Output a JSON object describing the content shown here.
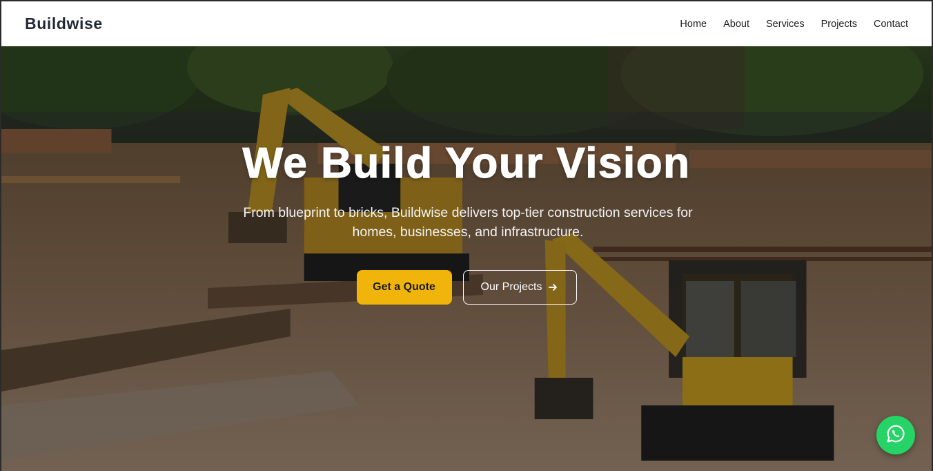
{
  "brand": {
    "name": "Buildwise"
  },
  "nav": {
    "items": [
      {
        "label": "Home"
      },
      {
        "label": "About"
      },
      {
        "label": "Services"
      },
      {
        "label": "Projects"
      },
      {
        "label": "Contact"
      }
    ]
  },
  "hero": {
    "title": "We Build Your Vision",
    "subtitle": "From blueprint to bricks, Buildwise delivers top-tier construction services for homes, businesses, and infrastructure.",
    "primary_cta": "Get a Quote",
    "secondary_cta": "Our Projects",
    "secondary_cta_icon": "arrow-right-icon",
    "background_image": "construction-site-excavators"
  },
  "floating": {
    "chat_icon": "whatsapp-icon"
  },
  "colors": {
    "accent": "#f1b40a",
    "nav_bg": "#ffffff",
    "logo_text": "#1f2a36",
    "whatsapp": "#25d366",
    "hero_text": "#ffffff"
  }
}
